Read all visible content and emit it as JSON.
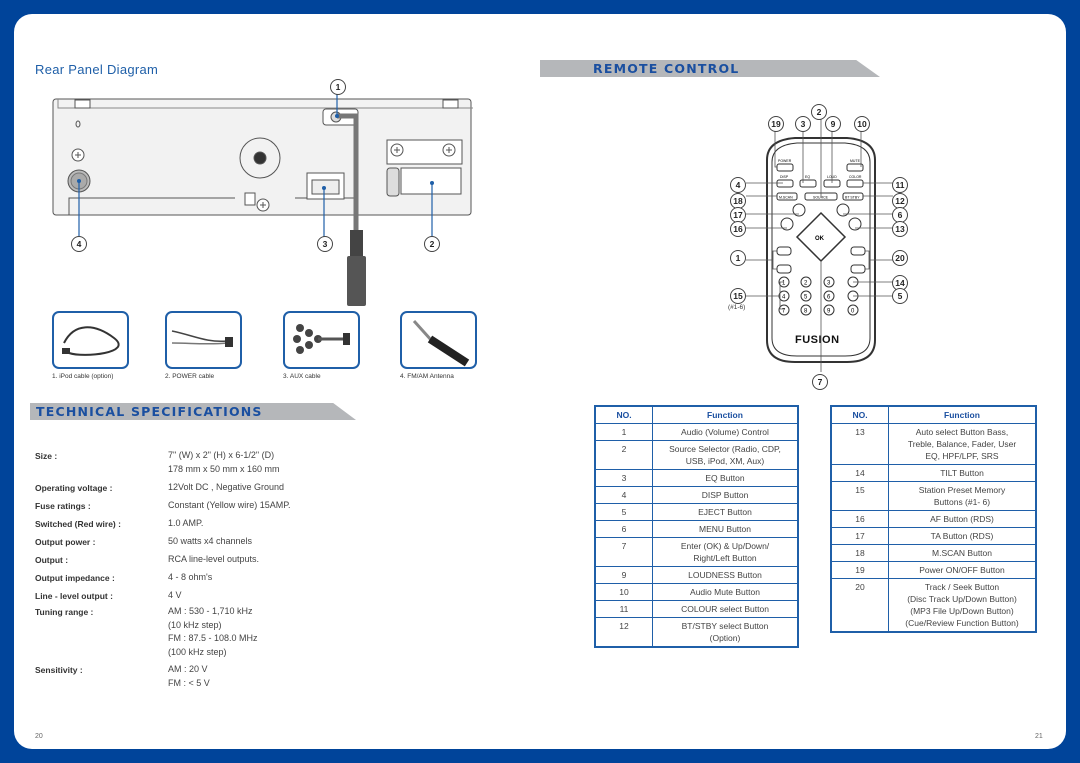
{
  "left_page": {
    "rear_panel": {
      "title": "Rear Panel Diagram",
      "callouts": [
        "1",
        "2",
        "3",
        "4"
      ]
    },
    "accessories": [
      {
        "caption": "1. iPod cable (option)",
        "icon": "ipod-cable-image"
      },
      {
        "caption": "2. POWER cable",
        "icon": "power-cable-image"
      },
      {
        "caption": "3. AUX cable",
        "icon": "aux-cable-image"
      },
      {
        "caption": "4. FM/AM Antenna",
        "icon": "antenna-image"
      }
    ],
    "tech_specs": {
      "title": "TECHNICAL SPECIFICATIONS",
      "rows": [
        {
          "label": "Size :",
          "value": [
            "7\" (W) x 2\" (H) x 6-1/2\" (D)",
            "178 mm x 50 mm x 160 mm"
          ]
        },
        {
          "label": "Operating voltage :",
          "value": [
            "12Volt DC , Negative Ground"
          ]
        },
        {
          "label": "Fuse ratings :",
          "value": [
            "Constant (Yellow wire) 15AMP."
          ]
        },
        {
          "label": "Switched (Red wire) :",
          "value": [
            "1.0 AMP."
          ]
        },
        {
          "label": "Output power :",
          "value": [
            "50 watts x4 channels"
          ]
        },
        {
          "label": "Output :",
          "value": [
            "RCA line-level outputs."
          ]
        },
        {
          "label": "Output impedance :",
          "value": [
            "4 - 8 ohm's"
          ]
        },
        {
          "label": "Line - level output :",
          "value": [
            "4 V"
          ]
        },
        {
          "label": "Tuning range :",
          "value": [
            "AM : 530 - 1,710 kHz",
            "(10 kHz step)",
            "FM : 87.5 - 108.0 MHz",
            "(100 kHz step)"
          ]
        },
        {
          "label": "Sensitivity :",
          "value": [
            "AM : 20 V",
            "FM : < 5 V"
          ]
        }
      ]
    },
    "page_number": "20"
  },
  "right_page": {
    "remote": {
      "title": "REMOTE CONTROL",
      "brand": "FUSION",
      "buttons": {
        "power": "POWER",
        "mute": "MUTE",
        "disp": "DISP",
        "eq": "EQ",
        "loud": "LOUD",
        "color": "COLOR",
        "mscan": "M.SCAN",
        "source": "SOURCE",
        "btstby": "BT STBY",
        "ta": "TA",
        "menu": "MENU",
        "af": "AF",
        "audio": "AUDIO",
        "ok": "OK",
        "vol": "VOL",
        "track": "TRACK",
        "tilt": "TILT",
        "eject": "EJECT",
        "digits": [
          "1",
          "2",
          "3",
          "4",
          "5",
          "6",
          "7",
          "8",
          "9",
          "0"
        ]
      },
      "preset_note": "(#1-6)",
      "callouts": [
        "19",
        "3",
        "2",
        "9",
        "10",
        "4",
        "11",
        "18",
        "12",
        "17",
        "6",
        "16",
        "13",
        "1",
        "20",
        "14",
        "15",
        "5",
        "7"
      ]
    },
    "function_tables": {
      "header_no": "NO.",
      "header_function": "Function",
      "left": [
        {
          "no": "1",
          "fn": [
            "Audio (Volume) Control"
          ]
        },
        {
          "no": "2",
          "fn": [
            "Source Selector (Radio, CDP,",
            "USB, iPod, XM, Aux)"
          ]
        },
        {
          "no": "3",
          "fn": [
            "EQ Button"
          ]
        },
        {
          "no": "4",
          "fn": [
            "DISP Button"
          ]
        },
        {
          "no": "5",
          "fn": [
            "EJECT Button"
          ]
        },
        {
          "no": "6",
          "fn": [
            "MENU Button"
          ]
        },
        {
          "no": "7",
          "fn": [
            "Enter (OK) & Up/Down/",
            "Right/Left Button"
          ]
        },
        {
          "no": "9",
          "fn": [
            "LOUDNESS Button"
          ]
        },
        {
          "no": "10",
          "fn": [
            "Audio Mute Button"
          ]
        },
        {
          "no": "11",
          "fn": [
            "COLOUR select Button"
          ]
        },
        {
          "no": "12",
          "fn": [
            "BT/STBY select Button",
            "(Option)"
          ]
        }
      ],
      "right": [
        {
          "no": "13",
          "fn": [
            "Auto select Button Bass,",
            "Treble, Balance, Fader, User",
            "EQ, HPF/LPF, SRS"
          ]
        },
        {
          "no": "14",
          "fn": [
            "TILT Button"
          ]
        },
        {
          "no": "15",
          "fn": [
            "Station Preset Memory",
            "Buttons (#1- 6)"
          ]
        },
        {
          "no": "16",
          "fn": [
            "AF Button (RDS)"
          ]
        },
        {
          "no": "17",
          "fn": [
            "TA Button (RDS)"
          ]
        },
        {
          "no": "18",
          "fn": [
            "M.SCAN Button"
          ]
        },
        {
          "no": "19",
          "fn": [
            "Power ON/OFF Button"
          ]
        },
        {
          "no": "20",
          "fn": [
            "Track / Seek Button",
            "(Disc Track Up/Down Button)",
            "(MP3 File Up/Down Button)",
            "(Cue/Review Function Button)"
          ]
        }
      ]
    },
    "page_number": "21"
  },
  "colors": {
    "frame": "#00449a",
    "accent": "#1f5fa8",
    "banner": "#b5b7ba"
  }
}
